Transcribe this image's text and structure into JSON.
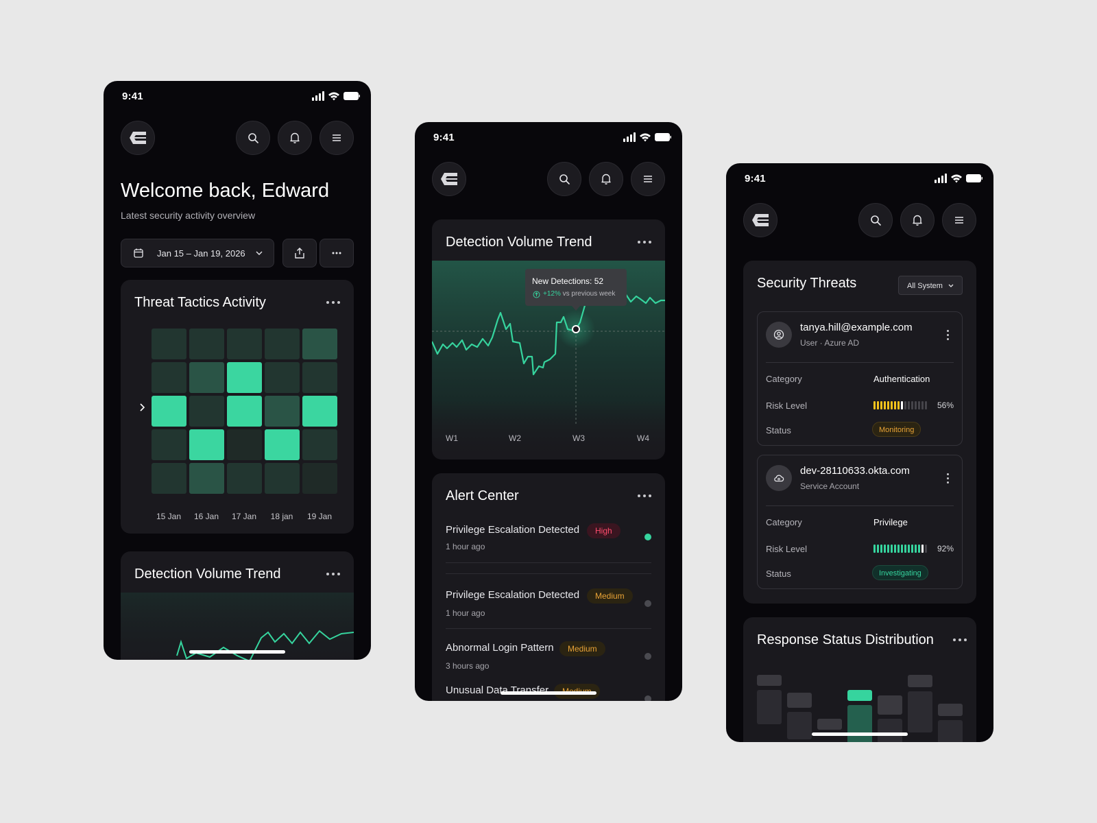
{
  "status_time": "9:41",
  "phone1": {
    "welcome": "Welcome back, Edward",
    "subtitle": "Latest security activity overview",
    "date_range": "Jan 15 – Jan 19, 2026",
    "threat_card": {
      "title": "Threat Tactics Activity",
      "days": [
        "15 Jan",
        "16 Jan",
        "17 Jan",
        "18 jan",
        "19 Jan"
      ],
      "intensity_rows": [
        [
          1,
          1,
          1,
          1,
          2
        ],
        [
          1,
          2,
          4,
          1,
          1
        ],
        [
          4,
          1,
          4,
          2,
          4
        ],
        [
          1,
          4,
          0,
          4,
          1
        ],
        [
          1,
          2,
          1,
          1,
          0
        ]
      ]
    },
    "detection_card": {
      "title": "Detection Volume Trend"
    }
  },
  "phone2": {
    "detection_card": {
      "title": "Detection Volume Trend",
      "tooltip_title": "New Detections: 52",
      "tooltip_change": "+12%",
      "tooltip_suffix": "vs previous week",
      "weeks": [
        "W1",
        "W2",
        "W3",
        "W4"
      ]
    },
    "alert_card": {
      "title": "Alert Center",
      "alerts": [
        {
          "title": "Privilege Escalation Detected",
          "badge": "High",
          "severity": "high",
          "time": "1 hour ago",
          "dot_color": "#36d49e"
        },
        {
          "title": "Privilege Escalation Detected",
          "badge": "Medium",
          "severity": "medium",
          "time": "1 hour ago",
          "dot_color": "#4a4a50"
        },
        {
          "title": "Abnormal Login Pattern",
          "badge": "Medium",
          "severity": "medium",
          "time": "3 hours ago",
          "dot_color": "#4a4a50"
        },
        {
          "title": "Unusual Data Transfer",
          "badge": "Medium",
          "severity": "medium",
          "time": "",
          "dot_color": "#4a4a50"
        }
      ]
    }
  },
  "phone3": {
    "threats_card": {
      "title": "Security Threats",
      "filter": "All System",
      "labels": {
        "category": "Category",
        "risk": "Risk Level",
        "status": "Status"
      },
      "threats": [
        {
          "name": "tanya.hill@example.com",
          "sub": "User · Azure AD",
          "category": "Authentication",
          "risk_percent": 56,
          "risk_label": "56%",
          "status": "Monitoring",
          "status_kind": "monitoring",
          "risk_color": "#f4c21b"
        },
        {
          "name": "dev-28110633.okta.com",
          "sub": "Service Account",
          "category": "Privilege",
          "risk_percent": 92,
          "risk_label": "92%",
          "status": "Investigating",
          "status_kind": "investigating",
          "risk_color": "#36d49e"
        }
      ]
    },
    "response_card": {
      "title": "Response Status Distribution"
    }
  },
  "colors": {
    "accent": "#36d49e",
    "background": "#08070b",
    "card": "#1a191e",
    "warning": "#e9a336",
    "danger": "#ff4d6d"
  }
}
